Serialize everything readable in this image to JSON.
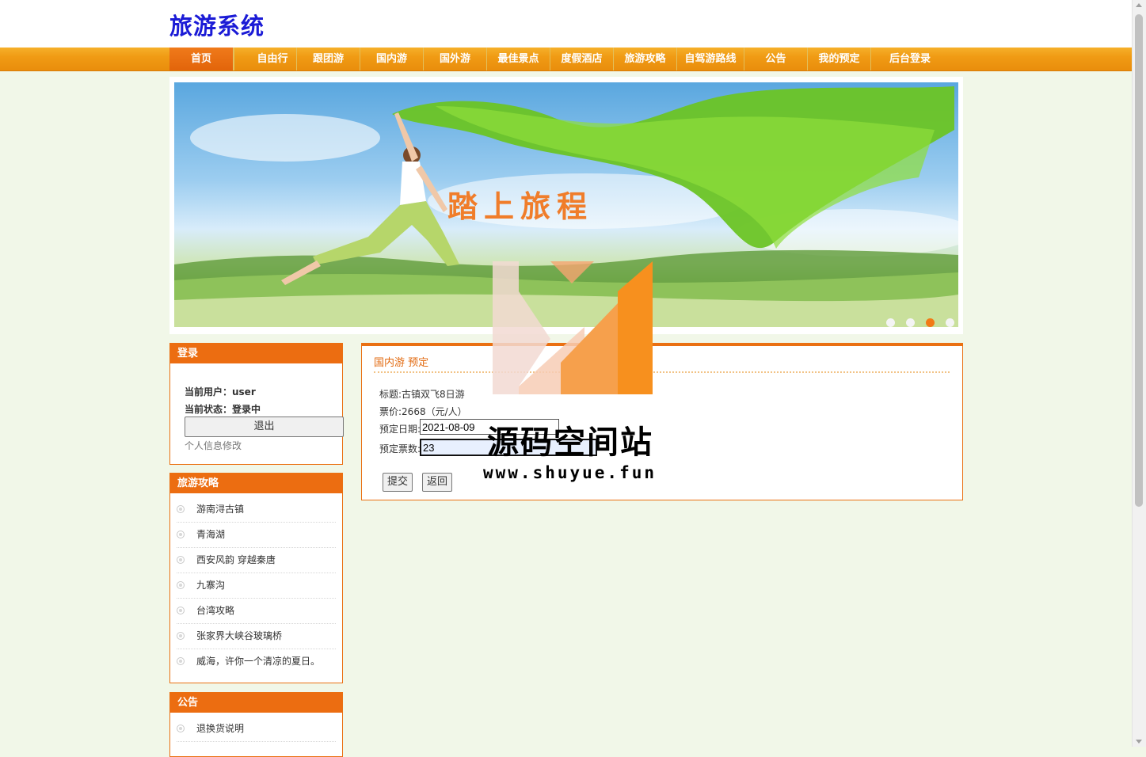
{
  "site": {
    "title": "旅游系统"
  },
  "nav": {
    "items": [
      {
        "label": "首页"
      },
      {
        "label": "自由行"
      },
      {
        "label": "跟团游"
      },
      {
        "label": "国内游"
      },
      {
        "label": "国外游"
      },
      {
        "label": "最佳景点"
      },
      {
        "label": "度假酒店"
      },
      {
        "label": "旅游攻略"
      },
      {
        "label": "自驾游路线"
      },
      {
        "label": "公告"
      },
      {
        "label": "我的预定"
      },
      {
        "label": "后台登录"
      }
    ],
    "active_index": 0
  },
  "banner": {
    "caption": "踏上旅程",
    "slide_count": 4,
    "active_slide": 3
  },
  "login": {
    "title": "登录",
    "user_line": "当前用户：user",
    "status_line": "当前状态：登录中",
    "logout_label": "退出",
    "profile_link": "个人信息修改"
  },
  "guides": {
    "title": "旅游攻略",
    "items": [
      "游南浔古镇",
      "青海湖",
      "西安风韵 穿越秦唐",
      "九寨沟",
      "台湾攻略",
      "张家界大峡谷玻璃桥",
      "威海，许你一个清凉的夏日。"
    ]
  },
  "notices": {
    "title": "公告",
    "items": [
      "退换货说明"
    ]
  },
  "booking": {
    "heading": "国内游 预定",
    "title_line": "标题:古镇双飞8日游",
    "price_line": "票价:2668（元/人）",
    "date_label": "预定日期:",
    "date_value": "2021-08-09",
    "count_label": "预定票数:",
    "count_value": "23",
    "submit_label": "提交",
    "back_label": "返回"
  },
  "watermark": {
    "text": "源码空间站",
    "url": "www.shuyue.fun"
  },
  "colors": {
    "accent": "#ec6d11",
    "nav": "#f09b14",
    "title": "#1b1bd6",
    "page_bg": "#f1f7e8"
  }
}
